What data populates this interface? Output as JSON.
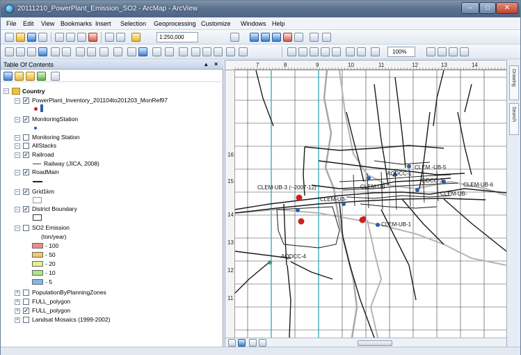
{
  "window": {
    "title": "20111210_PowerPlant_Emission_SO2 - ArcMap - ArcView"
  },
  "menu": [
    "File",
    "Edit",
    "View",
    "Bookmarks",
    "Insert",
    "Selection",
    "Geoprocessing",
    "Customize",
    "Windows",
    "Help"
  ],
  "toolbar": {
    "scale": "1:250,000",
    "zoom": "100%"
  },
  "toc": {
    "title": "Table Of Contents",
    "group": "Country",
    "layers": {
      "powerplant": "PowerPlant_Inventory_201104to201203_MonRef97",
      "monitoring_station": "MonitoringStation",
      "monitoring_station_2": "Monitoring Station",
      "allstacks": "AllStacks",
      "railroad": "Railroad",
      "railroad_legend": "Railway (JICA, 2008)",
      "roadmain": "RoadMain",
      "grid1km": "Grid1km",
      "district_boundary": "District Boundary",
      "so2_emission": "SO2 Emission",
      "so2_unit": "(ton/year)",
      "population": "PopulationByPlanningZones",
      "full_polygon_1": "FULL_polygon",
      "full_polygon_2": "FULL_polygon",
      "landsat": "Landsat Mosaics (1999-2002)"
    },
    "so2_classes": [
      {
        "label": "- 100",
        "color": "#f08a8a"
      },
      {
        "label": "- 50",
        "color": "#f7c56b"
      },
      {
        "label": "- 20",
        "color": "#e8f08a"
      },
      {
        "label": "- 10",
        "color": "#a8e88a"
      },
      {
        "label": "- 5",
        "color": "#7fb8f0"
      }
    ]
  },
  "map": {
    "ruler_top": [
      "7",
      "8",
      "9",
      "10",
      "11",
      "12",
      "13",
      "14"
    ],
    "ruler_left": [
      "15",
      "16",
      "14",
      "13",
      "12",
      "11"
    ],
    "labels": {
      "clem_ub5": "CLEM -UB-5",
      "aqdcc": "AQDCC-1",
      "qdcc3": "QDCC-3",
      "clem_ub3": "CLEM-UB-3 (~2007-12)",
      "clem_ub": "CLEM-UB-",
      "clem_ub6": "CLEM-UB-6",
      "clem_ub1": "CLEM-UB-1",
      "aqdcc4": "AQDCC-4"
    }
  },
  "dock": {
    "tab1": "Drawing",
    "tab2": "Search"
  },
  "colors": {
    "grid": "#3a3a3a",
    "grid_highlight": "#38b0b8",
    "station": "#2b5fa8",
    "plant": "#cc2020"
  }
}
